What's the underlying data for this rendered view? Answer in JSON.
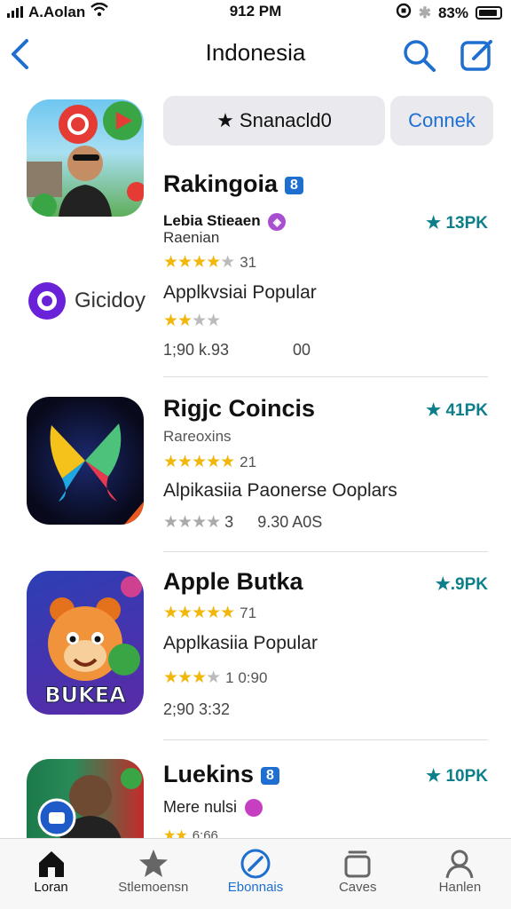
{
  "status": {
    "carrier": "A.Aolan",
    "time": "912 PM",
    "battery": "83%"
  },
  "nav": {
    "title": "Indonesia",
    "icons": [
      "chevron-left-icon",
      "search-icon",
      "compose-icon"
    ]
  },
  "search_pill": {
    "left_label": "★ Snanacld0",
    "right_label": "Connek"
  },
  "apps": [
    {
      "name": "Rakingoia",
      "badge": "8",
      "developer": "Lebia Stieaen",
      "subtitle": "Raenian",
      "stars": 4,
      "rating_count": "31",
      "rank": "★ 13PK",
      "secondary_logo": "Gicidoy",
      "category": "Applkvsiai Popular",
      "category_stars": 2,
      "meta_left": "1;90 k.93",
      "meta_right": "00"
    },
    {
      "name": "Rigjc Coincis",
      "subtitle": "Rareoxins",
      "stars": 5,
      "rating_count": "21",
      "rank": "★ 41PK",
      "category": "Alpikasiia Paonerse Ooplars",
      "category_stars": 4,
      "meta_left": "3",
      "meta_right": "9.30 A0S"
    },
    {
      "name": "Apple Butka",
      "stars": 5,
      "rating_count": "71",
      "rank": "★.9PK",
      "category": "Applkasiia Popular",
      "category_stars": 3,
      "meta_stars_text": "1  0:90",
      "meta_left": "2;90 3:32",
      "icon_text": "BUKEA"
    },
    {
      "name": "Luekins",
      "badge": "8",
      "developer": "Mere nulsi",
      "rank": "★ 10PK",
      "meta_left": "6:66"
    }
  ],
  "tabs": [
    {
      "label": "Loran",
      "icon": "home-icon"
    },
    {
      "label": "Stlemoensn",
      "icon": "star-icon"
    },
    {
      "label": "Ebonnais",
      "icon": "compose-icon"
    },
    {
      "label": "Caves",
      "icon": "stack-icon"
    },
    {
      "label": "Hanlen",
      "icon": "person-icon"
    }
  ],
  "colors": {
    "accent": "#1f6fd1",
    "star": "#f1b70b",
    "rank": "#0d7f8a"
  }
}
